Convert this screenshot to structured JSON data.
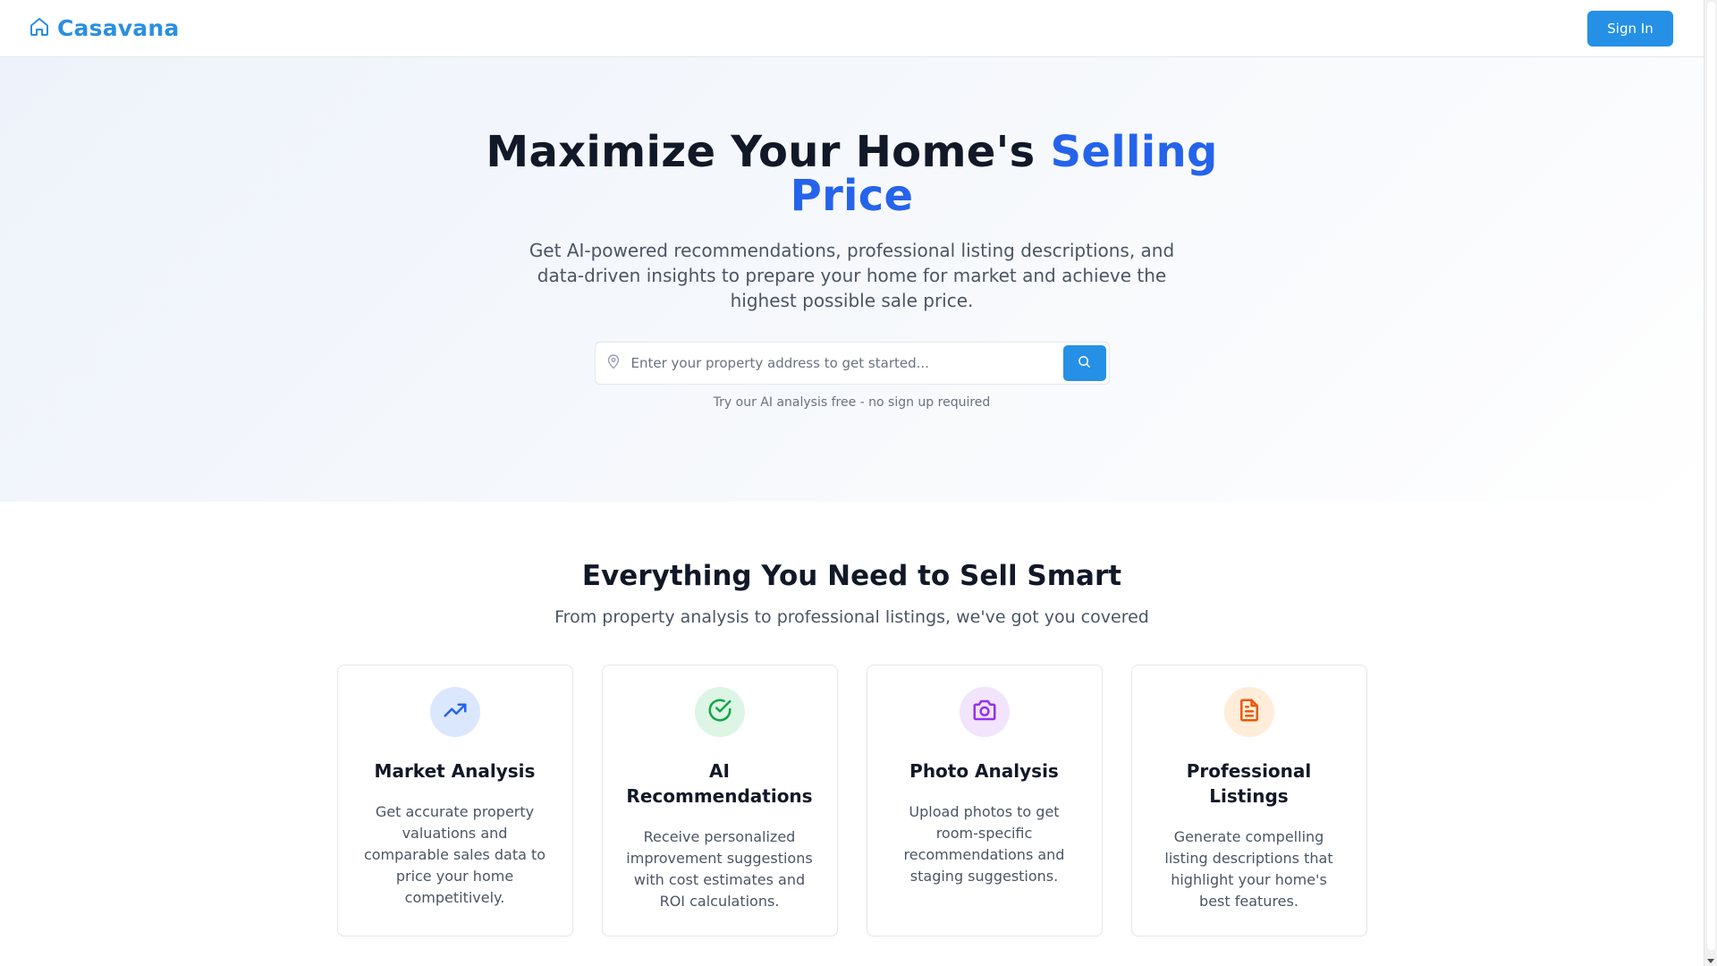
{
  "header": {
    "brand": "Casavana",
    "sign_in": "Sign In",
    "brand_color": "#2b8fe0"
  },
  "hero": {
    "title_main": "Maximize Your Home's",
    "title_accent": "Selling Price",
    "subtitle": "Get AI-powered recommendations, professional listing descriptions, and data-driven insights to prepare your home for market and achieve the highest possible sale price.",
    "search_placeholder": "Enter your property address to get started...",
    "hint": "Try our AI analysis free - no sign up required",
    "accent_color": "#2563eb"
  },
  "features": {
    "heading": "Everything You Need to Sell Smart",
    "lead": "From property analysis to professional listings, we've got you covered",
    "cards": [
      {
        "icon": "trending-up-icon",
        "title": "Market Analysis",
        "description": "Get accurate property valuations and comparable sales data to price your home competitively.",
        "icon_color": "#2563eb",
        "bg_color": "#dbe7fd"
      },
      {
        "icon": "check-circle-icon",
        "title": "AI Recommendations",
        "description": "Receive personalized improvement suggestions with cost estimates and ROI calculations.",
        "icon_color": "#16a34a",
        "bg_color": "#dcf5e4"
      },
      {
        "icon": "camera-icon",
        "title": "Photo Analysis",
        "description": "Upload photos to get room-specific recommendations and staging suggestions.",
        "icon_color": "#9333ea",
        "bg_color": "#f1e4fc"
      },
      {
        "icon": "document-icon",
        "title": "Professional Listings",
        "description": "Generate compelling listing descriptions that highlight your home's best features.",
        "icon_color": "#ea580c",
        "bg_color": "#ffedd9"
      }
    ]
  }
}
